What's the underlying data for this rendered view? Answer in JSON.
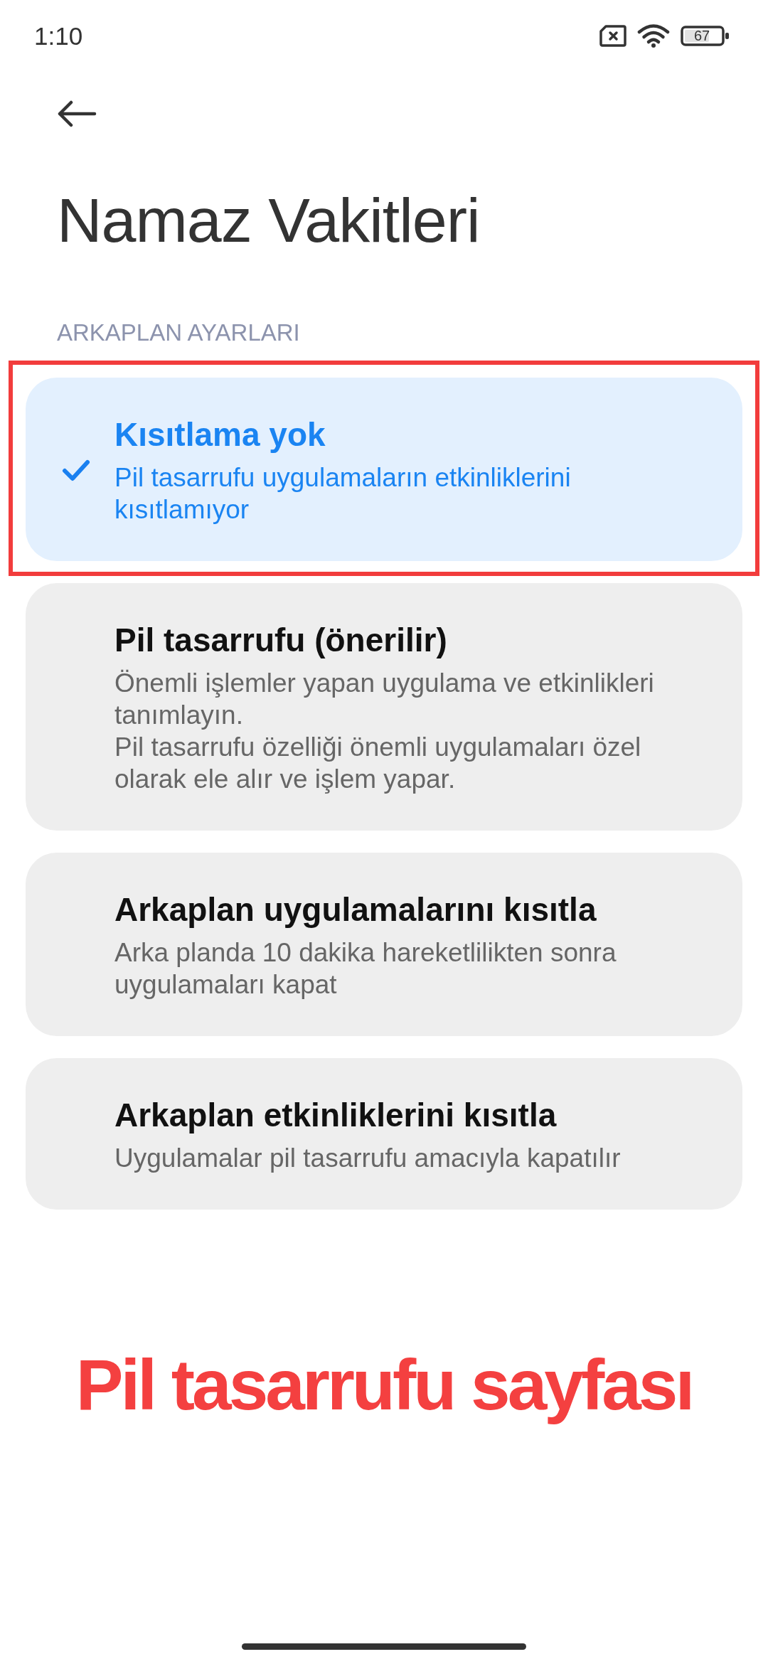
{
  "status_bar": {
    "time": "1:10",
    "battery": "67"
  },
  "header": {
    "title": "Namaz Vakitleri"
  },
  "section": {
    "label": "ARKAPLAN AYARLARI",
    "options": [
      {
        "title": "Kısıtlama yok",
        "description": "Pil tasarrufu uygulamaların etkinliklerini kısıtlamıyor",
        "selected": true,
        "highlighted": true
      },
      {
        "title": "Pil tasarrufu (önerilir)",
        "description": "Önemli işlemler yapan uygulama ve etkinlikleri tanımlayın.\nPil tasarrufu özelliği önemli uygulamaları özel olarak ele alır ve işlem yapar.",
        "selected": false,
        "highlighted": false
      },
      {
        "title": "Arkaplan uygulamalarını kısıtla",
        "description": "Arka planda 10 dakika hareketlilikten sonra uygulamaları kapat",
        "selected": false,
        "highlighted": false
      },
      {
        "title": "Arkaplan etkinliklerini kısıtla",
        "description": "Uygulamalar pil tasarrufu amacıyla kapatılır",
        "selected": false,
        "highlighted": false
      }
    ]
  },
  "annotation": {
    "caption": "Pil tasarrufu sayfası"
  }
}
